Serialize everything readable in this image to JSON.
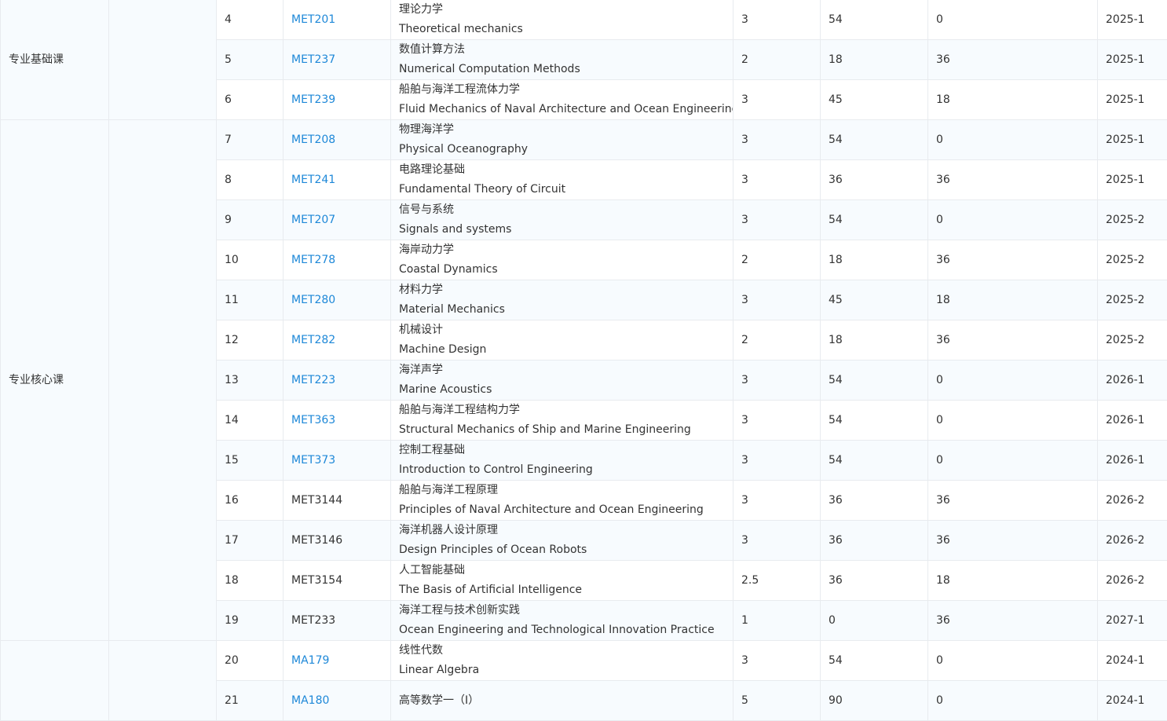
{
  "categories": [
    {
      "label": "专业基础课",
      "rows": 3
    },
    {
      "label": "专业核心课",
      "rows": 13
    },
    {
      "label": "",
      "rows": 2
    }
  ],
  "courses": [
    {
      "no": "4",
      "code": "MET201",
      "link": true,
      "name_zh": "理论力学",
      "name_en": "Theoretical mechanics",
      "credits": "3",
      "hours_theory": "54",
      "hours_practice": "0",
      "term": "2025-1"
    },
    {
      "no": "5",
      "code": "MET237",
      "link": true,
      "name_zh": "数值计算方法",
      "name_en": "Numerical Computation Methods",
      "credits": "2",
      "hours_theory": "18",
      "hours_practice": "36",
      "term": "2025-1"
    },
    {
      "no": "6",
      "code": "MET239",
      "link": true,
      "name_zh": "船舶与海洋工程流体力学",
      "name_en": "Fluid Mechanics of Naval Architecture and Ocean Engineering",
      "credits": "3",
      "hours_theory": "45",
      "hours_practice": "18",
      "term": "2025-1"
    },
    {
      "no": "7",
      "code": "MET208",
      "link": true,
      "name_zh": "物理海洋学",
      "name_en": "Physical Oceanography",
      "credits": "3",
      "hours_theory": "54",
      "hours_practice": "0",
      "term": "2025-1"
    },
    {
      "no": "8",
      "code": "MET241",
      "link": true,
      "name_zh": "电路理论基础",
      "name_en": "Fundamental Theory of Circuit",
      "credits": "3",
      "hours_theory": "36",
      "hours_practice": "36",
      "term": "2025-1"
    },
    {
      "no": "9",
      "code": "MET207",
      "link": true,
      "name_zh": "信号与系统",
      "name_en": "Signals and systems",
      "credits": "3",
      "hours_theory": "54",
      "hours_practice": "0",
      "term": "2025-2"
    },
    {
      "no": "10",
      "code": "MET278",
      "link": true,
      "name_zh": "海岸动力学",
      "name_en": "Coastal Dynamics",
      "credits": "2",
      "hours_theory": "18",
      "hours_practice": "36",
      "term": "2025-2"
    },
    {
      "no": "11",
      "code": "MET280",
      "link": true,
      "name_zh": "材料力学",
      "name_en": "Material Mechanics",
      "credits": "3",
      "hours_theory": "45",
      "hours_practice": "18",
      "term": "2025-2"
    },
    {
      "no": "12",
      "code": "MET282",
      "link": true,
      "name_zh": "机械设计",
      "name_en": "Machine Design",
      "credits": "2",
      "hours_theory": "18",
      "hours_practice": "36",
      "term": "2025-2"
    },
    {
      "no": "13",
      "code": "MET223",
      "link": true,
      "name_zh": "海洋声学",
      "name_en": "Marine Acoustics",
      "credits": "3",
      "hours_theory": "54",
      "hours_practice": "0",
      "term": "2026-1"
    },
    {
      "no": "14",
      "code": "MET363",
      "link": true,
      "name_zh": "船舶与海洋工程结构力学",
      "name_en": "Structural Mechanics of Ship and Marine Engineering",
      "credits": "3",
      "hours_theory": "54",
      "hours_practice": "0",
      "term": "2026-1"
    },
    {
      "no": "15",
      "code": "MET373",
      "link": true,
      "name_zh": "控制工程基础",
      "name_en": "Introduction to Control Engineering",
      "credits": "3",
      "hours_theory": "54",
      "hours_practice": "0",
      "term": "2026-1"
    },
    {
      "no": "16",
      "code": "MET3144",
      "link": false,
      "name_zh": "船舶与海洋工程原理",
      "name_en": "Principles of Naval Architecture and Ocean Engineering",
      "credits": "3",
      "hours_theory": "36",
      "hours_practice": "36",
      "term": "2026-2"
    },
    {
      "no": "17",
      "code": "MET3146",
      "link": false,
      "name_zh": "海洋机器人设计原理",
      "name_en": "Design Principles of Ocean Robots",
      "credits": "3",
      "hours_theory": "36",
      "hours_practice": "36",
      "term": "2026-2"
    },
    {
      "no": "18",
      "code": "MET3154",
      "link": false,
      "name_zh": "人工智能基础",
      "name_en": "The Basis of Artificial Intelligence",
      "credits": "2.5",
      "hours_theory": "36",
      "hours_practice": "18",
      "term": "2026-2"
    },
    {
      "no": "19",
      "code": "MET233",
      "link": false,
      "name_zh": "海洋工程与技术创新实践",
      "name_en": "Ocean Engineering and Technological Innovation Practice",
      "credits": "1",
      "hours_theory": "0",
      "hours_practice": "36",
      "term": "2027-1"
    },
    {
      "no": "20",
      "code": "MA179",
      "link": true,
      "name_zh": "线性代数",
      "name_en": "Linear Algebra",
      "credits": "3",
      "hours_theory": "54",
      "hours_practice": "0",
      "term": "2024-1"
    },
    {
      "no": "21",
      "code": "MA180",
      "link": true,
      "name_zh": "高等数学一（I）",
      "name_en": "",
      "credits": "5",
      "hours_theory": "90",
      "hours_practice": "0",
      "term": "2024-1"
    }
  ]
}
